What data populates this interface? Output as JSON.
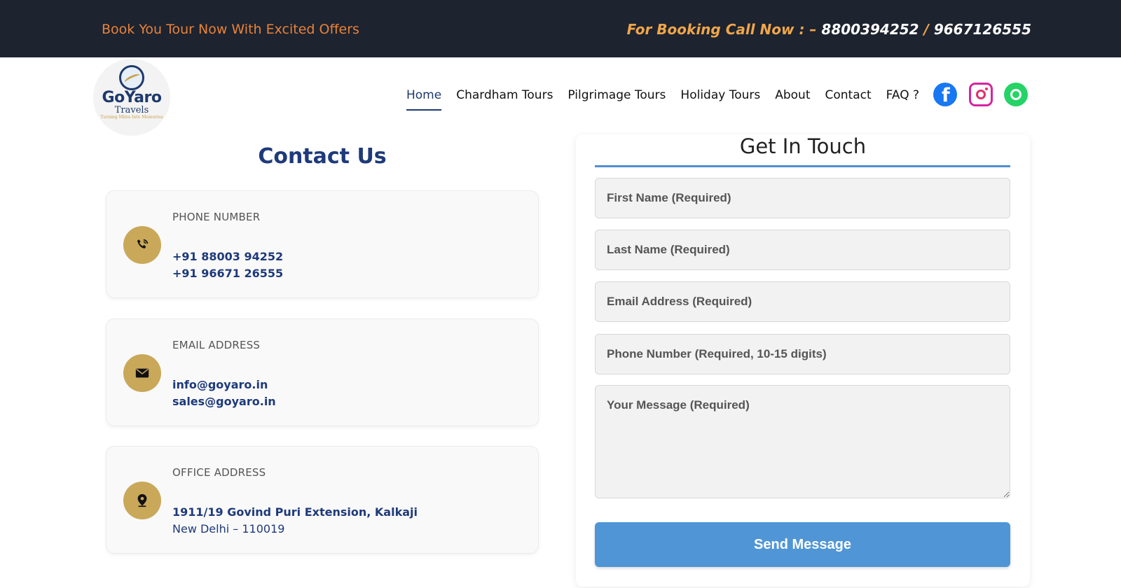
{
  "topbar": {
    "offer": "Book You Tour Now With Excited Offers",
    "booking_label": "For Booking Call Now : –",
    "phone1": "8800394252",
    "separator": "/",
    "phone2": "9667126555"
  },
  "logo": {
    "name": "GoYaro",
    "sub": "Travels",
    "tagline": "Turning Miles Into Memories"
  },
  "nav": {
    "items": [
      "Home",
      "Chardham Tours",
      "Pilgrimage Tours",
      "Holiday Tours",
      "About",
      "Contact",
      "FAQ ?"
    ],
    "active": "Home"
  },
  "social": {
    "icons": [
      "facebook-icon",
      "instagram-icon",
      "whatsapp-icon"
    ],
    "fb_glyph": "f"
  },
  "contact": {
    "title": "Contact Us",
    "phone": {
      "label": "PHONE NUMBER",
      "line1": "+91 88003 94252",
      "line2": "+91 96671 26555",
      "icon": "phone-icon"
    },
    "email": {
      "label": "EMAIL ADDRESS",
      "line1": "info@goyaro.in",
      "line2": "sales@goyaro.in",
      "icon": "mail-icon"
    },
    "office": {
      "label": "OFFICE ADDRESS",
      "line1": "1911/19 Govind Puri Extension, Kalkaji",
      "line2": "New Delhi – 110019",
      "icon": "location-pin-icon"
    }
  },
  "form": {
    "title": "Get In Touch",
    "first_name_placeholder": "First Name (Required)",
    "last_name_placeholder": "Last Name (Required)",
    "email_placeholder": "Email Address (Required)",
    "phone_placeholder": "Phone Number (Required, 10-15 digits)",
    "message_placeholder": "Your Message (Required)",
    "submit_label": "Send Message"
  },
  "colors": {
    "topbar_bg": "#1d232f",
    "offer_text": "#e8823a",
    "brand_navy": "#1e3a7a",
    "gold_accent": "#c9a85a",
    "button_blue": "#5096d6"
  }
}
